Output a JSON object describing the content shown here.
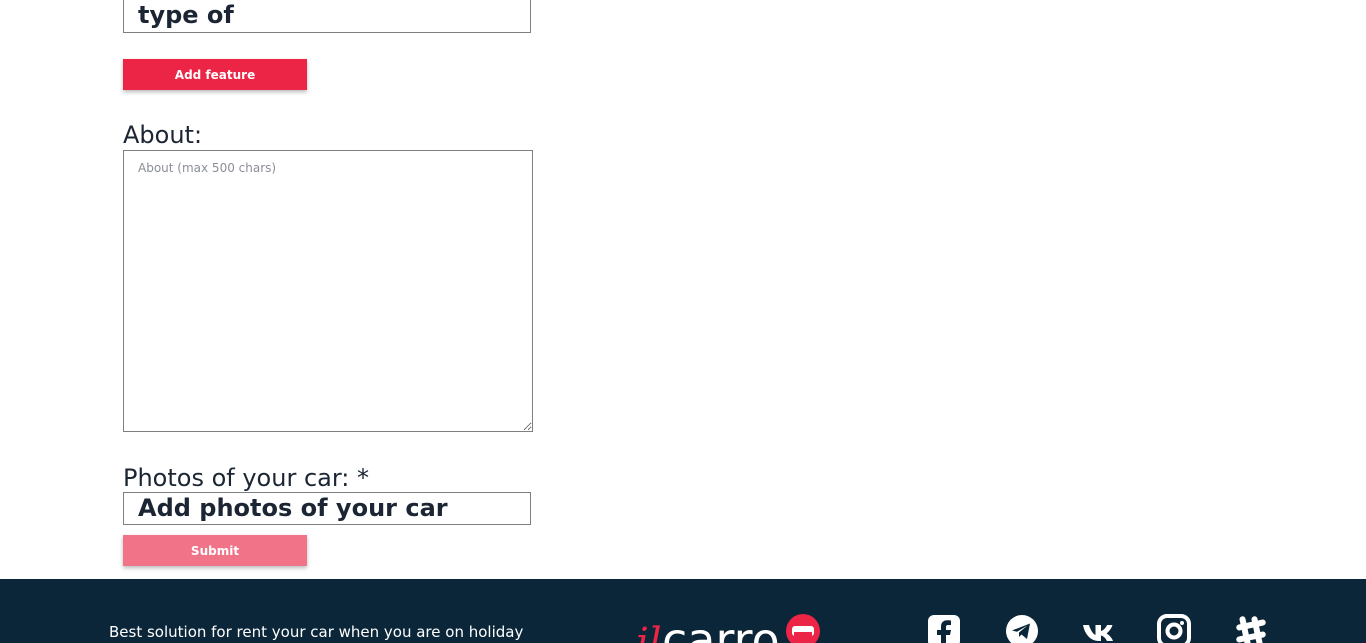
{
  "form": {
    "feature_value": "type of",
    "add_feature_label": "Add feature",
    "about_label": "About:",
    "about_placeholder": "About (max 500 chars)",
    "photos_label": "Photos of your car: *",
    "photos_value": "Add photos of your car",
    "submit_label": "Submit"
  },
  "footer": {
    "tagline": "Best solution for rent your car when you are on holiday",
    "logo": {
      "prefix": "il",
      "main": "carro"
    },
    "social_icons": [
      "facebook-icon",
      "telegram-icon",
      "vk-icon",
      "instagram-icon",
      "slack-icon"
    ]
  },
  "colors": {
    "accent": "#ec2546",
    "submit_disabled": "#f07388",
    "footer_bg": "#0b2638",
    "text": "#1b2533"
  }
}
